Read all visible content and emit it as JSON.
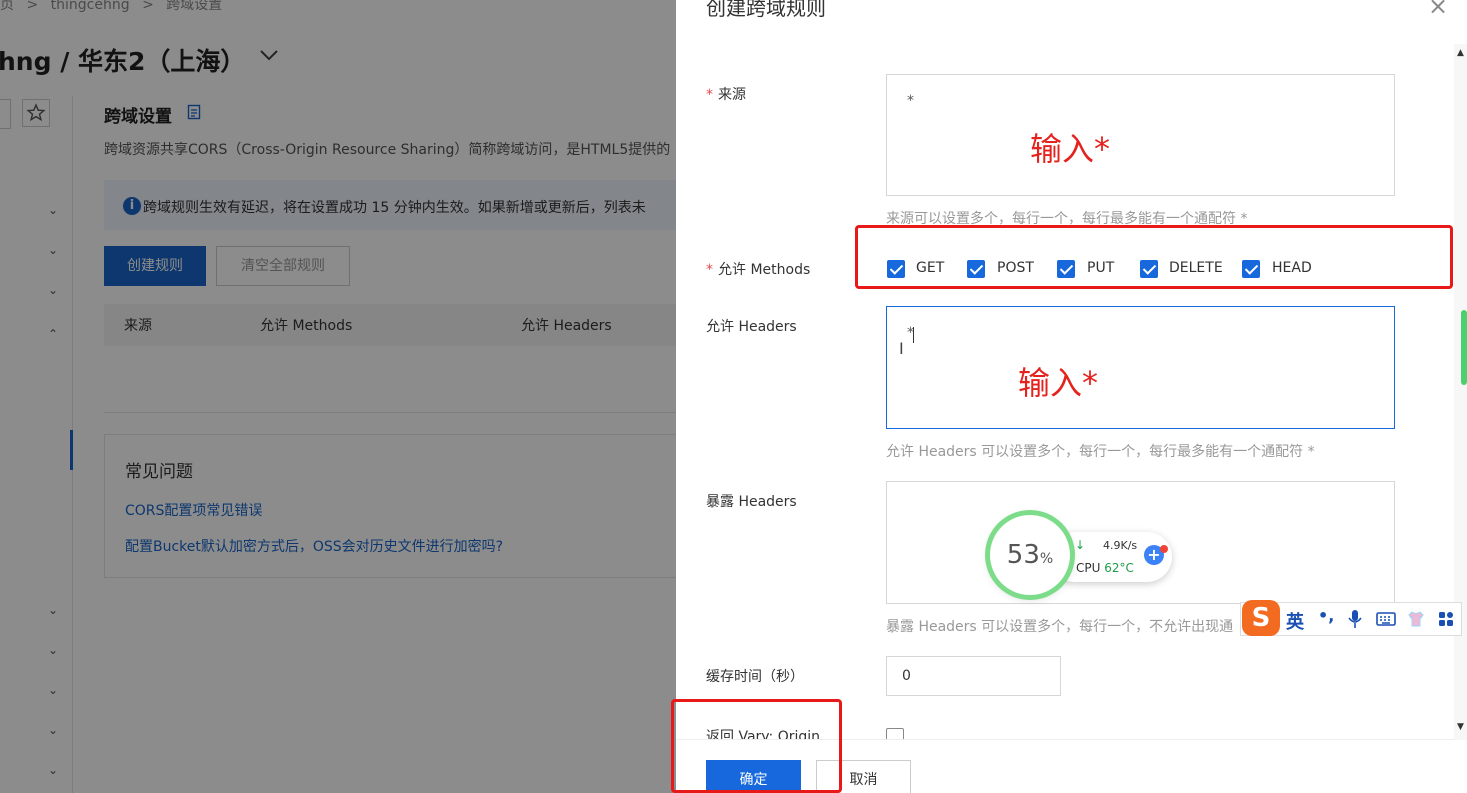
{
  "breadcrumb": {
    "items": [
      "页",
      "thingcehng",
      "跨域设置"
    ]
  },
  "header": {
    "title": "hng / 华东2（上海）"
  },
  "section": {
    "title": "跨域设置",
    "description": "跨域资源共享CORS（Cross-Origin Resource Sharing）简称跨域访问，是HTML5提供的",
    "notice": "跨域规则生效有延迟，将在设置成功 15 分钟内生效。如果新增或更新后，列表未",
    "create_button": "创建规则",
    "clear_button": "清空全部规则",
    "table_headers": [
      "来源",
      "允许 Methods",
      "允许 Headers"
    ]
  },
  "faq": {
    "title": "常见问题",
    "links": [
      "CORS配置项常见错误",
      "配置Bucket默认加密方式后，OSS会对历史文件进行加密吗?"
    ]
  },
  "drawer": {
    "title": "创建跨域规则",
    "close_label": "×",
    "fields": {
      "source": {
        "label": "来源",
        "required_mark": "*",
        "value": "*",
        "hint": "来源可以设置多个，每行一个，每行最多能有一个通配符 *"
      },
      "methods": {
        "label": "允许 Methods",
        "required_mark": "*",
        "options": [
          {
            "label": "GET",
            "checked": true
          },
          {
            "label": "POST",
            "checked": true
          },
          {
            "label": "PUT",
            "checked": true
          },
          {
            "label": "DELETE",
            "checked": true
          },
          {
            "label": "HEAD",
            "checked": true
          }
        ]
      },
      "allow_headers": {
        "label": "允许 Headers",
        "value": "*",
        "hint": "允许 Headers 可以设置多个，每行一个，每行最多能有一个通配符 *"
      },
      "expose_headers": {
        "label": "暴露 Headers",
        "value": "",
        "hint": "暴露 Headers 可以设置多个，每行一个，不允许出现通"
      },
      "cache_time": {
        "label": "缓存时间（秒）",
        "value": "0"
      },
      "vary_origin": {
        "label": "返回 Vary: Origin",
        "checked": false
      }
    },
    "confirm_button": "确定",
    "cancel_button": "取消"
  },
  "annotations": {
    "source_note": "输入*",
    "headers_note": "输入*"
  },
  "widget": {
    "percent": "53",
    "percent_unit": "%",
    "speed": "4.9K/s",
    "cpu_label": "CPU",
    "cpu_temp": "62°C"
  },
  "ime_bar": {
    "lang": "英",
    "punct": "•,"
  },
  "colors": {
    "primary": "#1668dc",
    "annotation_red": "#e5231e",
    "required_red": "#e5484d"
  }
}
